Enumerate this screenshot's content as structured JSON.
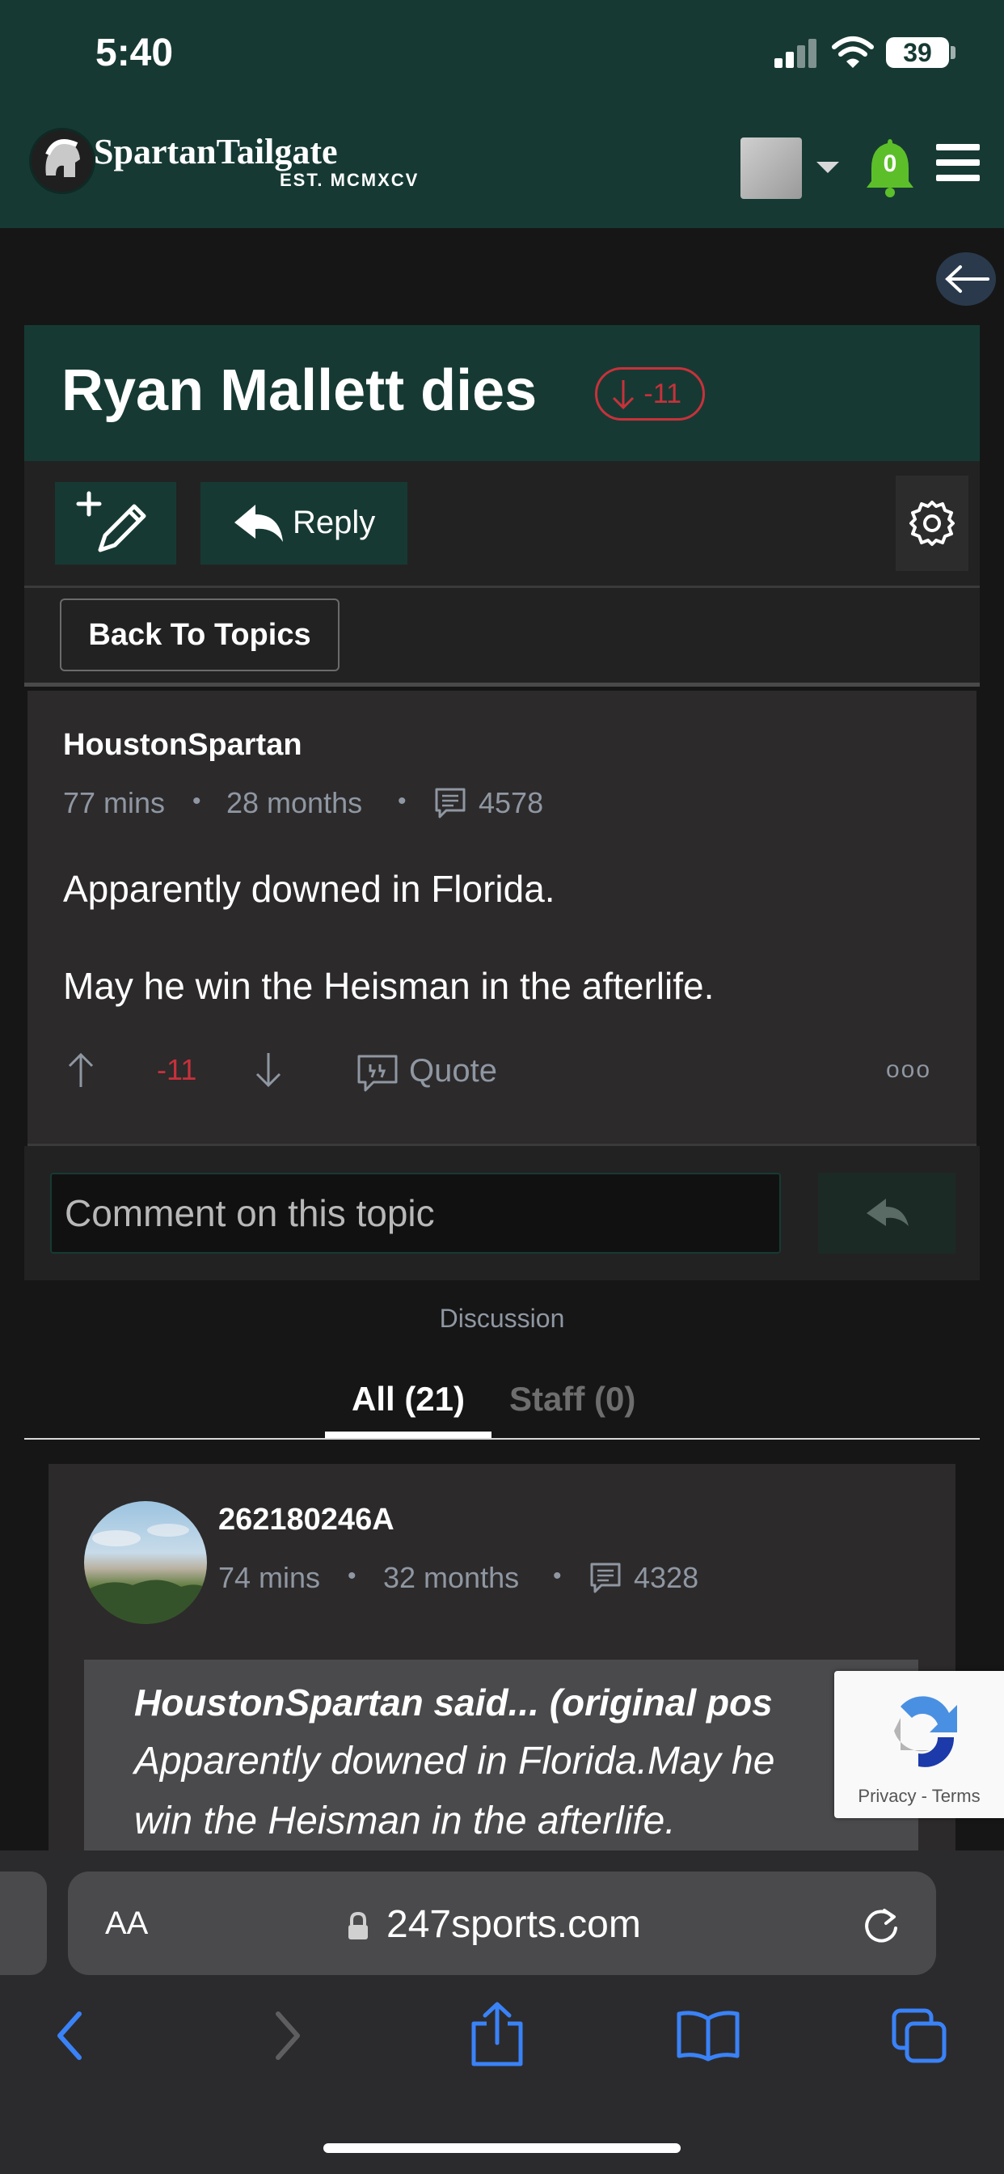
{
  "status_bar": {
    "time": "5:40",
    "battery": "39"
  },
  "header": {
    "logo_text": "SpartanTailgate",
    "logo_sub": "EST. MCMXCV",
    "notification_count": "0"
  },
  "topic": {
    "title": "Ryan Mallett dies",
    "score": "-11"
  },
  "actions": {
    "reply_label": "Reply",
    "back_label": "Back To Topics"
  },
  "post": {
    "author": "HoustonSpartan",
    "time": "77 mins",
    "membership": "28 months",
    "post_count": "4578",
    "body": [
      "Apparently downed in Florida.",
      "May he win the Heisman in the afterlife."
    ],
    "score": "-11",
    "quote_label": "Quote",
    "more_label": "ooo"
  },
  "comment_box": {
    "placeholder": "Comment on this topic"
  },
  "discussion": {
    "label": "Discussion",
    "tabs": [
      {
        "label": "All (21)",
        "active": true
      },
      {
        "label": "Staff (0)",
        "active": false
      }
    ]
  },
  "comment": {
    "author": "262180246A",
    "time": "74 mins",
    "membership": "32 months",
    "post_count": "4328",
    "quote_header": "HoustonSpartan said... (original pos",
    "quote_line1": "Apparently downed in Florida.May he",
    "quote_line2": "win the Heisman in the afterlife."
  },
  "recaptcha": {
    "privacy": "Privacy",
    "terms": "Terms"
  },
  "browser": {
    "aa_label": "AA",
    "url": "247sports.com"
  },
  "colors": {
    "brand_green": "#163a33",
    "negative": "#c8313b",
    "muted": "#8f97a2",
    "safari_blue": "#3a82f7"
  },
  "icons": [
    "signal-icon",
    "wifi-icon",
    "battery-icon",
    "helmet-logo-icon",
    "bell-icon",
    "hamburger-icon",
    "back-arrow-icon",
    "down-arrow-icon",
    "new-topic-icon",
    "reply-icon",
    "gear-icon",
    "comment-count-icon",
    "upvote-icon",
    "downvote-icon",
    "quote-icon",
    "send-icon",
    "lock-icon",
    "reload-icon",
    "back-chevron-icon",
    "forward-chevron-icon",
    "share-icon",
    "bookmarks-icon",
    "tabs-icon"
  ]
}
